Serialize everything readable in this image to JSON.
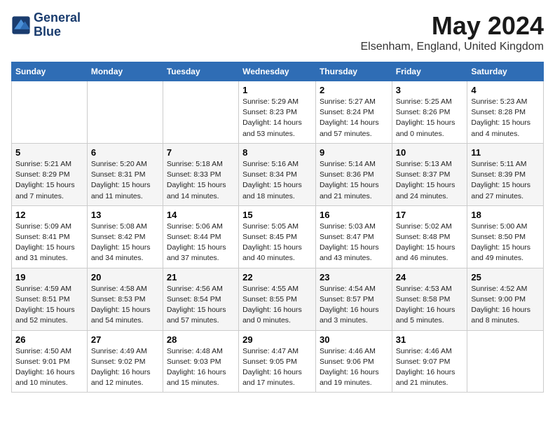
{
  "logo": {
    "line1": "General",
    "line2": "Blue"
  },
  "title": "May 2024",
  "subtitle": "Elsenham, England, United Kingdom",
  "headers": [
    "Sunday",
    "Monday",
    "Tuesday",
    "Wednesday",
    "Thursday",
    "Friday",
    "Saturday"
  ],
  "weeks": [
    [
      {
        "day": "",
        "info": ""
      },
      {
        "day": "",
        "info": ""
      },
      {
        "day": "",
        "info": ""
      },
      {
        "day": "1",
        "info": "Sunrise: 5:29 AM\nSunset: 8:23 PM\nDaylight: 14 hours and 53 minutes."
      },
      {
        "day": "2",
        "info": "Sunrise: 5:27 AM\nSunset: 8:24 PM\nDaylight: 14 hours and 57 minutes."
      },
      {
        "day": "3",
        "info": "Sunrise: 5:25 AM\nSunset: 8:26 PM\nDaylight: 15 hours and 0 minutes."
      },
      {
        "day": "4",
        "info": "Sunrise: 5:23 AM\nSunset: 8:28 PM\nDaylight: 15 hours and 4 minutes."
      }
    ],
    [
      {
        "day": "5",
        "info": "Sunrise: 5:21 AM\nSunset: 8:29 PM\nDaylight: 15 hours and 7 minutes."
      },
      {
        "day": "6",
        "info": "Sunrise: 5:20 AM\nSunset: 8:31 PM\nDaylight: 15 hours and 11 minutes."
      },
      {
        "day": "7",
        "info": "Sunrise: 5:18 AM\nSunset: 8:33 PM\nDaylight: 15 hours and 14 minutes."
      },
      {
        "day": "8",
        "info": "Sunrise: 5:16 AM\nSunset: 8:34 PM\nDaylight: 15 hours and 18 minutes."
      },
      {
        "day": "9",
        "info": "Sunrise: 5:14 AM\nSunset: 8:36 PM\nDaylight: 15 hours and 21 minutes."
      },
      {
        "day": "10",
        "info": "Sunrise: 5:13 AM\nSunset: 8:37 PM\nDaylight: 15 hours and 24 minutes."
      },
      {
        "day": "11",
        "info": "Sunrise: 5:11 AM\nSunset: 8:39 PM\nDaylight: 15 hours and 27 minutes."
      }
    ],
    [
      {
        "day": "12",
        "info": "Sunrise: 5:09 AM\nSunset: 8:41 PM\nDaylight: 15 hours and 31 minutes."
      },
      {
        "day": "13",
        "info": "Sunrise: 5:08 AM\nSunset: 8:42 PM\nDaylight: 15 hours and 34 minutes."
      },
      {
        "day": "14",
        "info": "Sunrise: 5:06 AM\nSunset: 8:44 PM\nDaylight: 15 hours and 37 minutes."
      },
      {
        "day": "15",
        "info": "Sunrise: 5:05 AM\nSunset: 8:45 PM\nDaylight: 15 hours and 40 minutes."
      },
      {
        "day": "16",
        "info": "Sunrise: 5:03 AM\nSunset: 8:47 PM\nDaylight: 15 hours and 43 minutes."
      },
      {
        "day": "17",
        "info": "Sunrise: 5:02 AM\nSunset: 8:48 PM\nDaylight: 15 hours and 46 minutes."
      },
      {
        "day": "18",
        "info": "Sunrise: 5:00 AM\nSunset: 8:50 PM\nDaylight: 15 hours and 49 minutes."
      }
    ],
    [
      {
        "day": "19",
        "info": "Sunrise: 4:59 AM\nSunset: 8:51 PM\nDaylight: 15 hours and 52 minutes."
      },
      {
        "day": "20",
        "info": "Sunrise: 4:58 AM\nSunset: 8:53 PM\nDaylight: 15 hours and 54 minutes."
      },
      {
        "day": "21",
        "info": "Sunrise: 4:56 AM\nSunset: 8:54 PM\nDaylight: 15 hours and 57 minutes."
      },
      {
        "day": "22",
        "info": "Sunrise: 4:55 AM\nSunset: 8:55 PM\nDaylight: 16 hours and 0 minutes."
      },
      {
        "day": "23",
        "info": "Sunrise: 4:54 AM\nSunset: 8:57 PM\nDaylight: 16 hours and 3 minutes."
      },
      {
        "day": "24",
        "info": "Sunrise: 4:53 AM\nSunset: 8:58 PM\nDaylight: 16 hours and 5 minutes."
      },
      {
        "day": "25",
        "info": "Sunrise: 4:52 AM\nSunset: 9:00 PM\nDaylight: 16 hours and 8 minutes."
      }
    ],
    [
      {
        "day": "26",
        "info": "Sunrise: 4:50 AM\nSunset: 9:01 PM\nDaylight: 16 hours and 10 minutes."
      },
      {
        "day": "27",
        "info": "Sunrise: 4:49 AM\nSunset: 9:02 PM\nDaylight: 16 hours and 12 minutes."
      },
      {
        "day": "28",
        "info": "Sunrise: 4:48 AM\nSunset: 9:03 PM\nDaylight: 16 hours and 15 minutes."
      },
      {
        "day": "29",
        "info": "Sunrise: 4:47 AM\nSunset: 9:05 PM\nDaylight: 16 hours and 17 minutes."
      },
      {
        "day": "30",
        "info": "Sunrise: 4:46 AM\nSunset: 9:06 PM\nDaylight: 16 hours and 19 minutes."
      },
      {
        "day": "31",
        "info": "Sunrise: 4:46 AM\nSunset: 9:07 PM\nDaylight: 16 hours and 21 minutes."
      },
      {
        "day": "",
        "info": ""
      }
    ]
  ]
}
